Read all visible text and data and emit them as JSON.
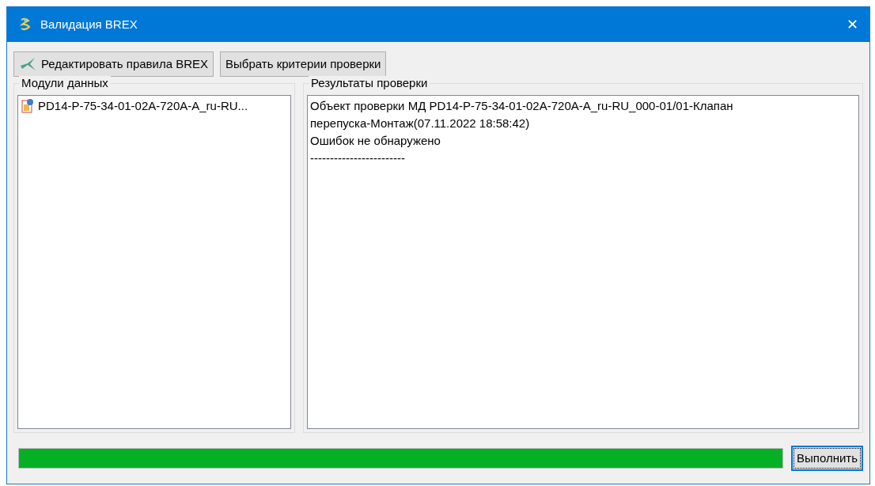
{
  "window": {
    "title": "Валидация BREX",
    "close": "✕"
  },
  "toolbar": [
    {
      "label": "Редактировать правила BREX",
      "kind": "icon"
    },
    {
      "label": "Выбрать критерии проверки",
      "kind": "plain"
    }
  ],
  "modules": {
    "title": "Модули данных",
    "items": [
      {
        "label": "PD14-P-75-34-01-02A-720A-A_ru-RU..."
      }
    ]
  },
  "results": {
    "title": "Результаты проверки",
    "lines": [
      "Объект проверки МД PD14-P-75-34-01-02A-720A-A_ru-RU_000-01/01-Клапан",
      "перепуска-Монтаж(07.11.2022 18:58:42)",
      "Ошибок не обнаружено",
      "------------------------"
    ]
  },
  "progress": {
    "level": 1
  },
  "run_button": {
    "label": "Выполнить",
    "focused": true
  }
}
